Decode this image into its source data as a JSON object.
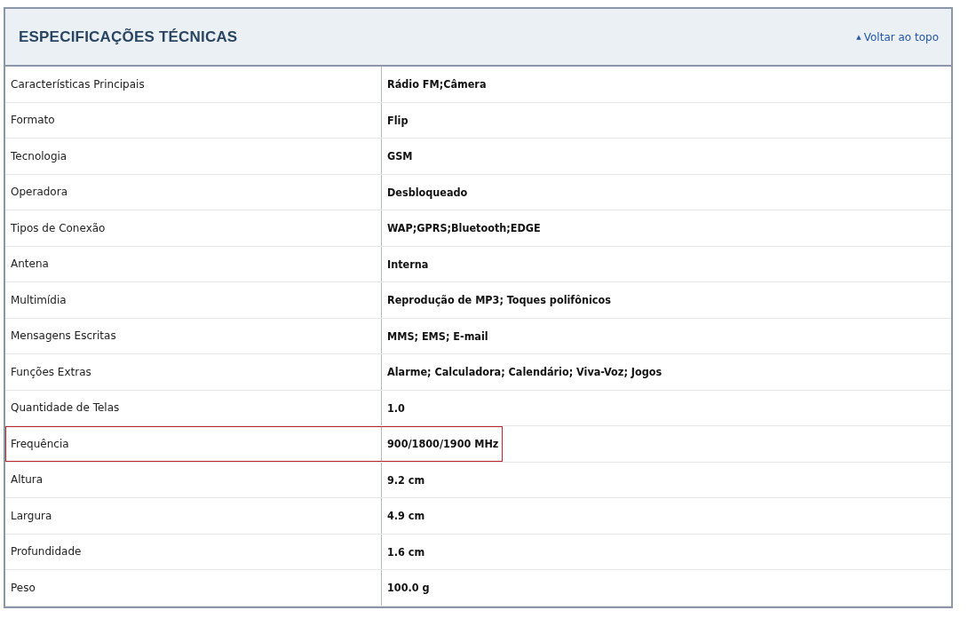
{
  "section": {
    "title": "ESPECIFICAÇÕES TÉCNICAS",
    "back_link": {
      "arrow": "▲",
      "label": "Voltar ao topo"
    }
  },
  "specs": [
    {
      "label": "Características Principais",
      "value": "Rádio FM;Câmera",
      "highlighted": false
    },
    {
      "label": "Formato",
      "value": "Flip",
      "highlighted": false
    },
    {
      "label": "Tecnologia",
      "value": "GSM",
      "highlighted": false
    },
    {
      "label": "Operadora",
      "value": "Desbloqueado",
      "highlighted": false
    },
    {
      "label": "Tipos de Conexão",
      "value": "WAP;GPRS;Bluetooth;EDGE",
      "highlighted": false
    },
    {
      "label": "Antena",
      "value": "Interna",
      "highlighted": false
    },
    {
      "label": "Multimídia",
      "value": "Reprodução de MP3; Toques polifônicos",
      "highlighted": false
    },
    {
      "label": "Mensagens Escritas",
      "value": "MMS; EMS; E-mail",
      "highlighted": false
    },
    {
      "label": "Funções Extras",
      "value": "Alarme; Calculadora; Calendário; Viva-Voz; Jogos",
      "highlighted": false
    },
    {
      "label": "Quantidade de Telas",
      "value": "1.0",
      "highlighted": false
    },
    {
      "label": "Frequência",
      "value": "900/1800/1900 MHz",
      "highlighted": true
    },
    {
      "label": "Altura",
      "value": "9.2 cm",
      "highlighted": false
    },
    {
      "label": "Largura",
      "value": "4.9 cm",
      "highlighted": false
    },
    {
      "label": "Profundidade",
      "value": "1.6 cm",
      "highlighted": false
    },
    {
      "label": "Peso",
      "value": "100.0 g",
      "highlighted": false
    }
  ]
}
